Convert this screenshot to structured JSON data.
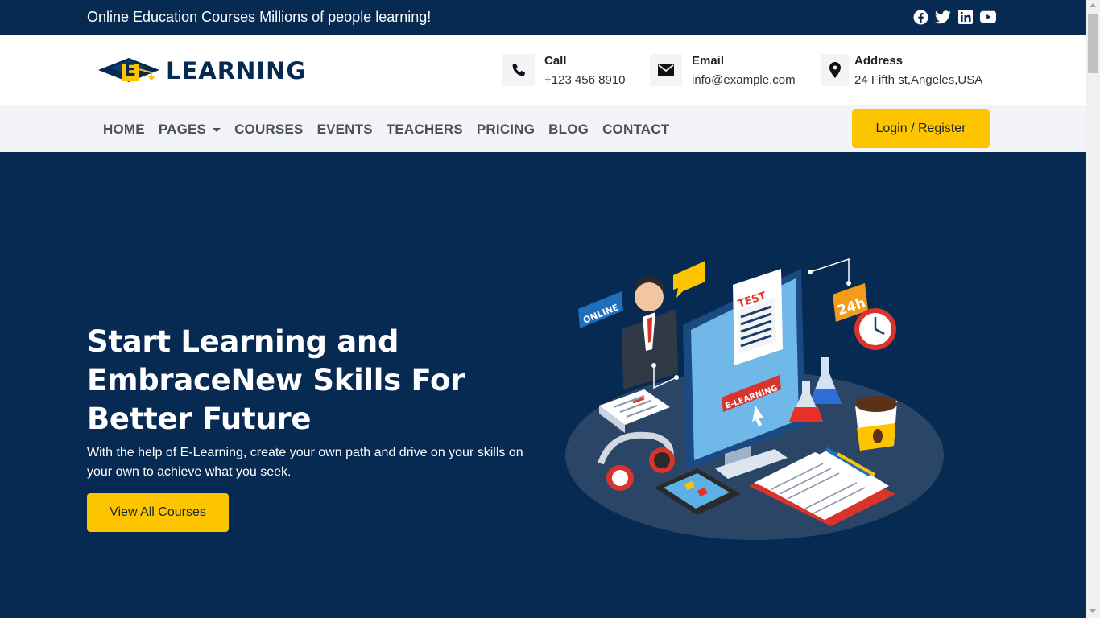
{
  "topbar": {
    "tagline": "Online Education Courses Millions of people learning!",
    "socials": [
      "facebook-icon",
      "twitter-icon",
      "linkedin-icon",
      "youtube-icon"
    ]
  },
  "header": {
    "logo_text": "LEARNING",
    "logo_mark": "E",
    "contacts": [
      {
        "label": "Call",
        "value": "+123 456 8910",
        "icon": "phone-icon"
      },
      {
        "label": "Email",
        "value": "info@example.com",
        "icon": "envelope-icon"
      },
      {
        "label": "Address",
        "value": "24 Fifth st,Angeles,USA",
        "icon": "map-marker-icon"
      }
    ]
  },
  "nav": {
    "items": [
      "HOME",
      "PAGES",
      "COURSES",
      "EVENTS",
      "TEACHERS",
      "PRICING",
      "BLOG",
      "CONTACT"
    ],
    "login_label": "Login / Register"
  },
  "hero": {
    "title": "Start Learning and EmbraceNew Skills For Better Future",
    "subtitle": "With the help of E-Learning, create your own path and drive on your skills on your own to achieve what you seek.",
    "button_label": "View All Courses",
    "illustration": {
      "badge_online": "ONLINE",
      "badge_24h": "24h",
      "paper_test": "TEST",
      "screen_label": "E-LEARNING"
    }
  },
  "colors": {
    "navy": "#062a52",
    "accent": "#fdc500",
    "nav_bg": "#f3f4f7"
  }
}
